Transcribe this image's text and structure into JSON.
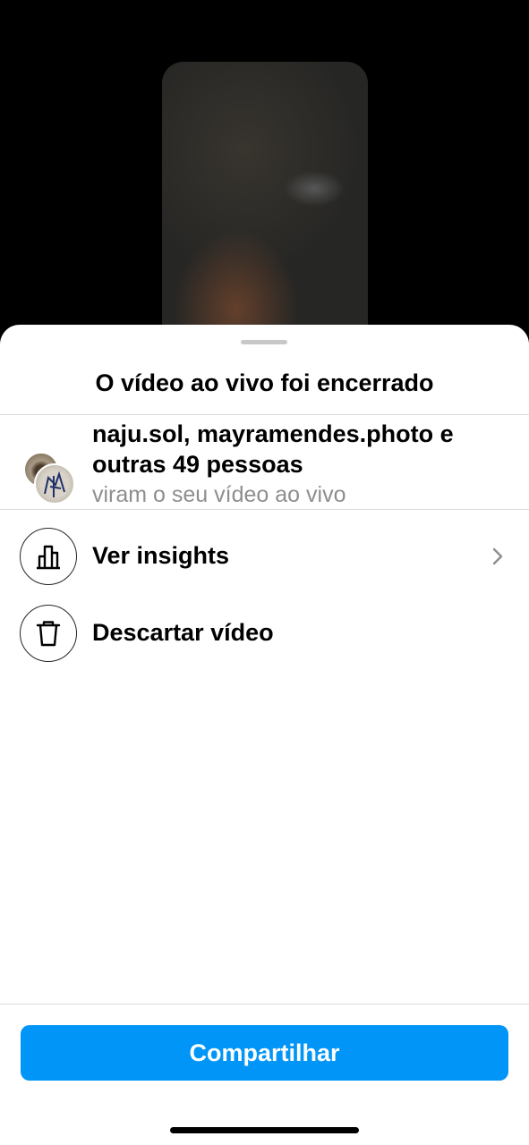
{
  "sheet": {
    "title": "O vídeo ao vivo foi encerrado"
  },
  "viewers": {
    "names": "naju.sol, mayramendes.photo e outras 49 pessoas",
    "subtitle": "viram o seu vídeo ao vivo"
  },
  "options": [
    {
      "label": "Ver insights",
      "icon": "bar-chart-icon",
      "has_chevron": true
    },
    {
      "label": "Descartar vídeo",
      "icon": "trash-icon",
      "has_chevron": false
    }
  ],
  "share_button": {
    "label": "Compartilhar",
    "color": "#0095f6"
  }
}
